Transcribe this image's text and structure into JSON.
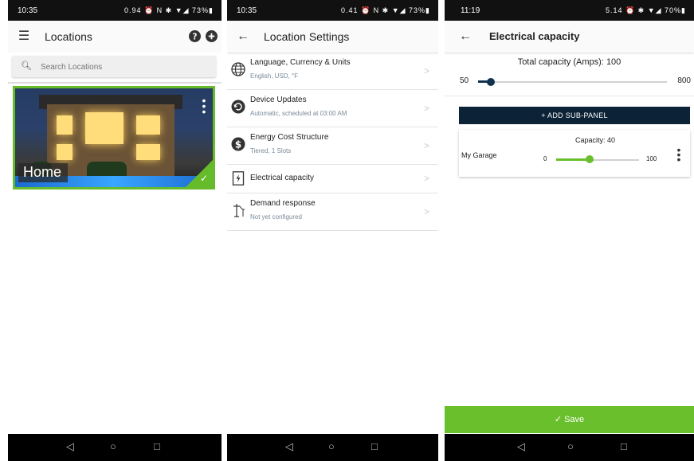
{
  "colors": {
    "accent_green": "#69bf2c",
    "navy": "#0c2236",
    "slider_navy": "#11324f"
  },
  "screen1": {
    "status": {
      "time": "10:35",
      "icons": "0.94 ⏰ N ✱ ▼◢ 73%▮"
    },
    "appbar": {
      "title": "Locations",
      "menu_icon": "hamburger-icon",
      "help_icon": "help-icon",
      "add_icon": "add-icon"
    },
    "search": {
      "placeholder": "Search Locations"
    },
    "location_card": {
      "label": "Home",
      "selected": true
    }
  },
  "screen2": {
    "status": {
      "time": "10:35",
      "icons": "0.41 ⏰ N ✱ ▼◢ 73%▮"
    },
    "appbar": {
      "title": "Location Settings"
    },
    "items": [
      {
        "title": "Language, Currency & Units",
        "subtitle": "English, USD, °F",
        "icon": "globe-icon"
      },
      {
        "title": "Device Updates",
        "subtitle": "Automatic, scheduled at 03:00 AM",
        "icon": "update-icon"
      },
      {
        "title": "Energy Cost Structure",
        "subtitle": "Tiered, 1 Slots",
        "icon": "dollar-icon"
      },
      {
        "title": "Electrical capacity",
        "subtitle": "",
        "icon": "electrical-panel-icon"
      },
      {
        "title": "Demand response",
        "subtitle": "Not yet configured",
        "icon": "power-line-icon"
      }
    ]
  },
  "screen3": {
    "status": {
      "time": "11:19",
      "icons": "5.14 ⏰ ✱ ▼◢ 70%▮"
    },
    "appbar": {
      "title": "Electrical capacity"
    },
    "total": {
      "label": "Total capacity (Amps): 100",
      "min": "50",
      "max": "800",
      "value": 100,
      "range": [
        50,
        800
      ]
    },
    "add_button": "+ ADD SUB-PANEL",
    "subpanel": {
      "name": "My Garage",
      "capacity_label": "Capacity: 40",
      "min": "0",
      "max": "100",
      "value": 40,
      "range": [
        0,
        100
      ]
    },
    "save": "Save"
  },
  "navbar": {
    "back": "◁",
    "home": "○",
    "recent": "□"
  }
}
